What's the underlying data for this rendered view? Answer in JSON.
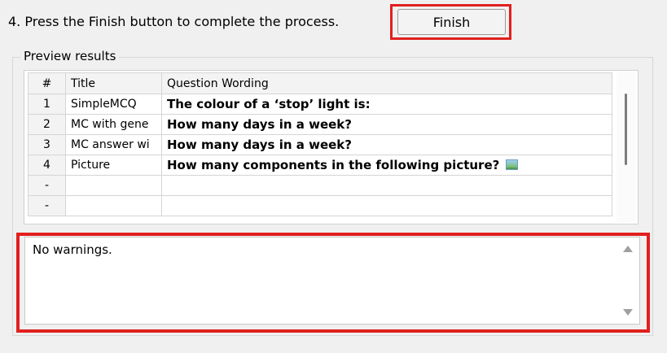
{
  "step": {
    "text": "4.  Press the Finish button to complete the process."
  },
  "finish_button": {
    "label": "Finish"
  },
  "preview": {
    "legend": "Preview results",
    "columns": [
      "#",
      "Title",
      "Question Wording"
    ],
    "rows": [
      {
        "num": "1",
        "title": "SimpleMCQ",
        "question": "The colour of a ‘stop’ light is:",
        "has_picture": false
      },
      {
        "num": "2",
        "title": "MC with gene",
        "question": "How many days in a week?",
        "has_picture": false
      },
      {
        "num": "3",
        "title": "MC answer wi",
        "question": "How many days in a week?",
        "has_picture": false
      },
      {
        "num": "4",
        "title": "Picture",
        "question": "How many components in the following picture?",
        "has_picture": true
      },
      {
        "num": "-",
        "title": "",
        "question": "",
        "has_picture": false
      },
      {
        "num": "-",
        "title": "",
        "question": "",
        "has_picture": false
      }
    ]
  },
  "warnings": {
    "text": "No warnings."
  },
  "colors": {
    "highlight": "#e0201e",
    "background": "#f0f0f0"
  },
  "icons": {
    "picture": "picture-icon",
    "scroll_up": "scroll-up-arrow-icon",
    "scroll_down": "scroll-down-arrow-icon"
  }
}
